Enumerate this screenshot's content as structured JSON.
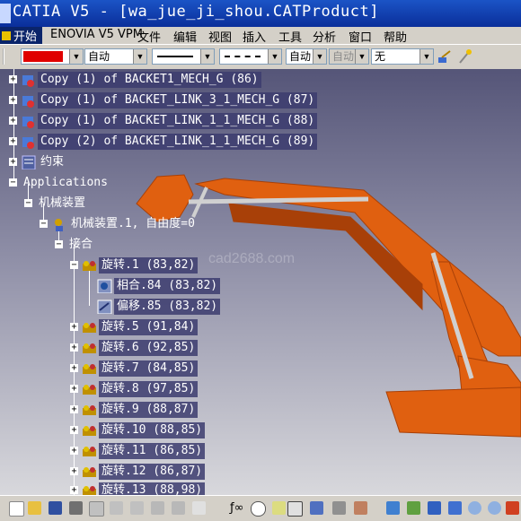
{
  "window": {
    "title": "CATIA V5 - [wa_jue_ji_shou.CATProduct]"
  },
  "menu": {
    "start": "开始",
    "items": [
      "ENOVIA V5 VPM",
      "文件",
      "编辑",
      "视图",
      "插入",
      "工具",
      "分析",
      "窗口",
      "帮助"
    ]
  },
  "toolbar": {
    "color_swatch": "#e00000",
    "color_auto": "自动",
    "line_type_auto": "自动",
    "weight_auto": "自动",
    "layer": "无"
  },
  "tree": {
    "nodes": [
      {
        "label": "Copy (1) of BACKET1_MECH_G (86)",
        "icon": "product-icon"
      },
      {
        "label": "Copy (1) of BACKET_LINK_3_1_MECH_G (87)",
        "icon": "product-icon"
      },
      {
        "label": "Copy (1) of BACKET_LINK_1_1_MECH_G (88)",
        "icon": "product-icon"
      },
      {
        "label": "Copy (2) of BACKET_LINK_1_1_MECH_G (89)",
        "icon": "product-icon"
      },
      {
        "label": "约束",
        "icon": "constraints-icon"
      },
      {
        "label": "Applications",
        "icon": ""
      },
      {
        "label": "机械装置",
        "icon": ""
      },
      {
        "label": "机械装置.1, 自由度=0",
        "icon": "mechanism-icon"
      },
      {
        "label": "接合",
        "icon": ""
      },
      {
        "label": "旋转.1 (83,82)",
        "icon": "joint-icon"
      },
      {
        "label": "相合.84 (83,82)",
        "icon": "coincidence-icon"
      },
      {
        "label": "偏移.85 (83,82)",
        "icon": "offset-icon"
      },
      {
        "label": "旋转.5 (91,84)",
        "icon": "joint-icon"
      },
      {
        "label": "旋转.6 (92,85)",
        "icon": "joint-icon"
      },
      {
        "label": "旋转.7 (84,85)",
        "icon": "joint-icon"
      },
      {
        "label": "旋转.8 (97,85)",
        "icon": "joint-icon"
      },
      {
        "label": "旋转.9 (88,87)",
        "icon": "joint-icon"
      },
      {
        "label": "旋转.10 (88,85)",
        "icon": "joint-icon"
      },
      {
        "label": "旋转.11 (86,85)",
        "icon": "joint-icon"
      },
      {
        "label": "旋转.12 (86,87)",
        "icon": "joint-icon"
      },
      {
        "label": "旋转.13 (88,98)",
        "icon": "joint-icon"
      }
    ]
  },
  "watermark": "cad2688.com",
  "model": {
    "color": "#e06010",
    "shade": "#a84008"
  }
}
